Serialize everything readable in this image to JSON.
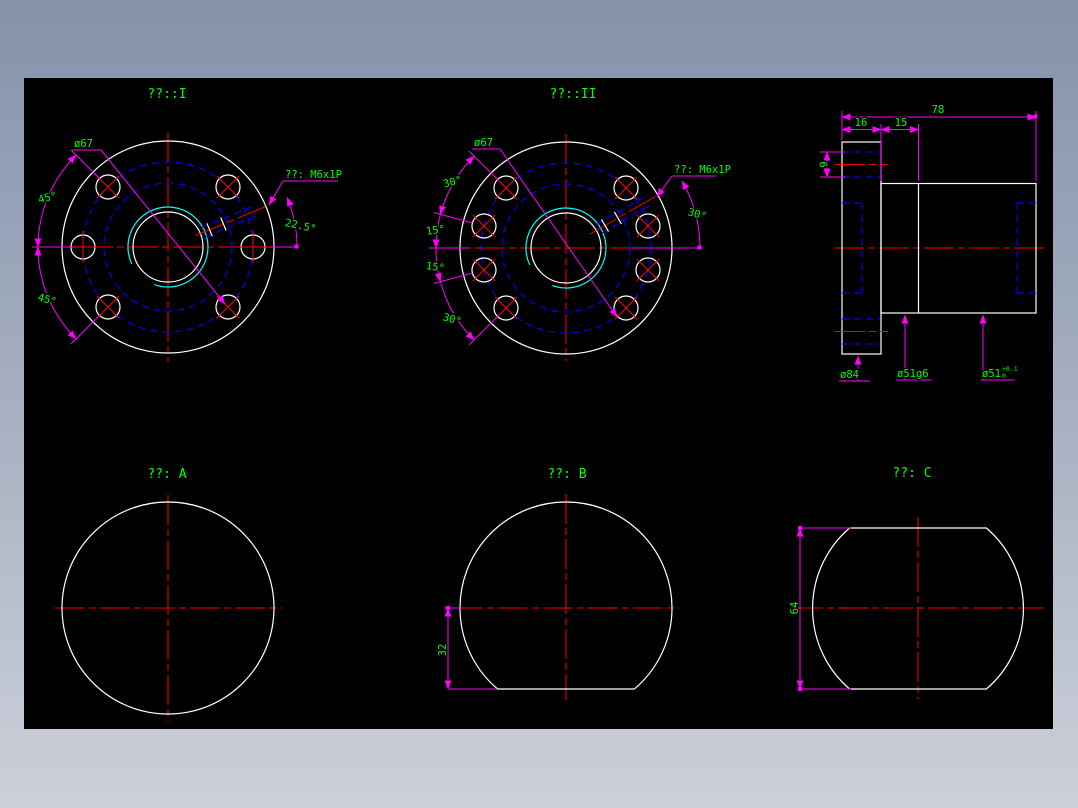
{
  "app": {
    "description": "CAD drawing preview of flanged ball screw nut, six views on black model space"
  },
  "colors": {
    "background_top": "#8493aa",
    "background_bottom": "#ccd0da",
    "canvas": "#000000",
    "outline_white": "#ffffff",
    "centerline_red": "#ff0000",
    "dimension_magenta": "#ff00ff",
    "text_green": "#00ff00",
    "hidden_blue": "#0000ff",
    "thread_cyan": "#00ffff"
  },
  "views": {
    "front_i": {
      "title": "??::I",
      "dia_label": "ø67",
      "thread_label": "??: M6x1P",
      "angle_upper": "45°",
      "angle_lower": "45°",
      "thread_angle": "22.5°"
    },
    "front_ii": {
      "title": "??::II",
      "dia_label": "ø67",
      "thread_label": "??: M6x1P",
      "angle_1": "30°",
      "angle_2": "15°",
      "angle_3": "15°",
      "angle_4": "30°",
      "thread_angle": "30°"
    },
    "side": {
      "dim_total": "78",
      "dim_flange_w": "16",
      "dim_seg": "15",
      "dim_bolt_hole": "9",
      "dia_flange": "ø84",
      "dia_body": "ø51g6",
      "dia_end": "ø51",
      "tol_upper": "+0.1",
      "tol_lower": "0"
    },
    "section_a": {
      "title": "??: A"
    },
    "section_b": {
      "title": "??: B",
      "dim_flat": "32"
    },
    "section_c": {
      "title": "??: C",
      "dim_height": "64"
    }
  }
}
